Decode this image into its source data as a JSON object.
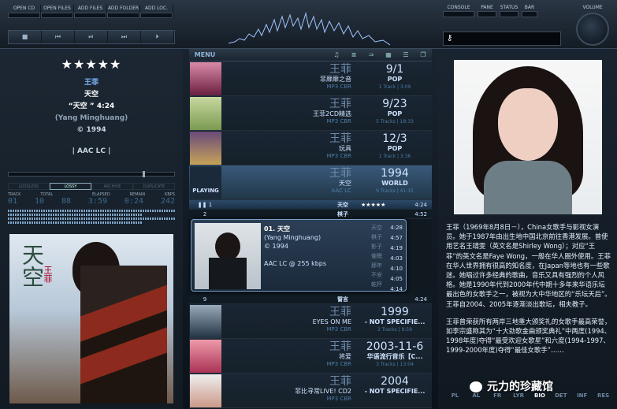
{
  "toolbar": {
    "buttons": [
      "OPEN CD",
      "OPEN FILES",
      "ADD FILES",
      "ADD FOLDER",
      "ADD LOC."
    ],
    "transport": [
      "■",
      "⏮",
      "⏯",
      "⏭",
      "⏵"
    ],
    "right_buttons": [
      "CONSOLE",
      "PANE",
      "STATUS",
      "BAR"
    ],
    "volume_label": "VOLUME",
    "search_icon": "key-icon"
  },
  "now_playing": {
    "stars": "★★★★★",
    "artist": "王菲",
    "album": "天空",
    "track": "“天空 ” 4:24",
    "original": "(Yang Minghuang)",
    "year": "© 1994",
    "codec": "| AAC LC |",
    "modes": [
      "LOSSLESS",
      "LOSSY",
      "ARCHIVE",
      "DUPLICATE"
    ],
    "active_mode": "LOSSY",
    "stat_headers": [
      "TRACK",
      "TOTAL",
      "",
      "ELAPSED",
      "REMAIN",
      "KBPS"
    ],
    "stat_values": [
      "01",
      "10",
      "88",
      "3:59",
      "0:24",
      "242"
    ],
    "cover_title": "天空",
    "cover_artist": "王菲",
    "seek_fraction": 0.84
  },
  "playlist": {
    "menu_label": "MENU",
    "albums": [
      {
        "artist": "王菲",
        "title": "菲靡靡之音",
        "fmt": "MP3 CBR",
        "date": "9/1",
        "genre": "POP",
        "tracks": "1 Track | 3:09"
      },
      {
        "artist": "王菲",
        "title": "王菲2CD精选",
        "fmt": "MP3 CBR",
        "date": "9/23",
        "genre": "POP",
        "tracks": "5 Tracks | 18:33"
      },
      {
        "artist": "王菲",
        "title": "玩具",
        "fmt": "MP3 CBR",
        "date": "12/3",
        "genre": "POP",
        "tracks": "1 Track | 3:36"
      },
      {
        "artist": "王菲",
        "title": "天空",
        "fmt": "AAC LC",
        "date": "1994",
        "genre": "WORLD",
        "tracks": "9 Tracks | 41:15",
        "playing_label": "PLAYING"
      }
    ],
    "tracks": [
      {
        "n": "1",
        "title": "天空",
        "stars": "★★★★★",
        "dur": "4:24",
        "current": true
      },
      {
        "n": "2",
        "title": "棋子",
        "stars": "",
        "dur": "4:52",
        "current": false
      }
    ],
    "popup": {
      "title": "01. 天空",
      "orig": "(Yang Minghuang)",
      "year": "© 1994",
      "codec": "AAC LC @ 255 kbps",
      "list": [
        "天空",
        "棋子",
        "影子",
        "催眠",
        "那年",
        "不安",
        "乾杯",
        "邀请"
      ],
      "durs": [
        "4:28",
        "4:57",
        "4:19",
        "4:03",
        "4:10",
        "4:05",
        "4:14",
        "4:33"
      ]
    },
    "track9": {
      "n": "9",
      "title": "誓言",
      "dur": "4:24"
    },
    "albums_after": [
      {
        "artist": "王菲",
        "title": "EYES ON ME",
        "fmt": "MP3 CBR",
        "date": "1999",
        "genre": "- NOT SPECIFIE...",
        "tracks": "2 Tracks | 9:59"
      },
      {
        "artist": "王菲",
        "title": "将爱",
        "fmt": "MP3 CBR",
        "date": "2003-11-6",
        "genre": "华语流行音乐【C...",
        "tracks": "3 Tracks | 13:04"
      },
      {
        "artist": "王菲",
        "title": "菲比寻常LIVE! CD2",
        "fmt": "MP3 CBR",
        "date": "2004",
        "genre": "- NOT SPECIFIE...",
        "tracks": ""
      }
    ]
  },
  "bio": {
    "p1": "王菲（1969年8月8日－），China女歌手与影视女演员。她于1987年由出生地中国北京前往香港发展。曾使用艺名王靖雯（英文名是Shirley Wong）；对应“王菲”的英文名是Faye Wong，一般在华人圈外使用。王菲在华人世界拥有很高的知名度，在Japan等地也有一些歌迷。她唱过许多经典的歌曲，音乐又具有强烈的个人风格。她是1990年代到2000年代中期十多年来华语乐坛最出色的女歌手之一，被视为大中华地区的“乐坛天后”。王菲自2004、2005年逐渐淡出歌坛，相夫教子。",
    "p2": "王菲曾荣获所有两岸三地重大颁奖礼的女歌手最高荣誉，如李宗盛称其为“十大劲歌金曲颁奖典礼”中两度(1994、1998年度)夺得“最受欢迎女歌星”和六度(1994-1997、1999-2000年度)夺得“最佳女歌手”……",
    "tabs": [
      "PL",
      "AL",
      "FR",
      "LYR",
      "BIO",
      "DET",
      "INF",
      "RES"
    ],
    "active_tab": "BIO"
  },
  "watermark": "元力的珍藏馆"
}
